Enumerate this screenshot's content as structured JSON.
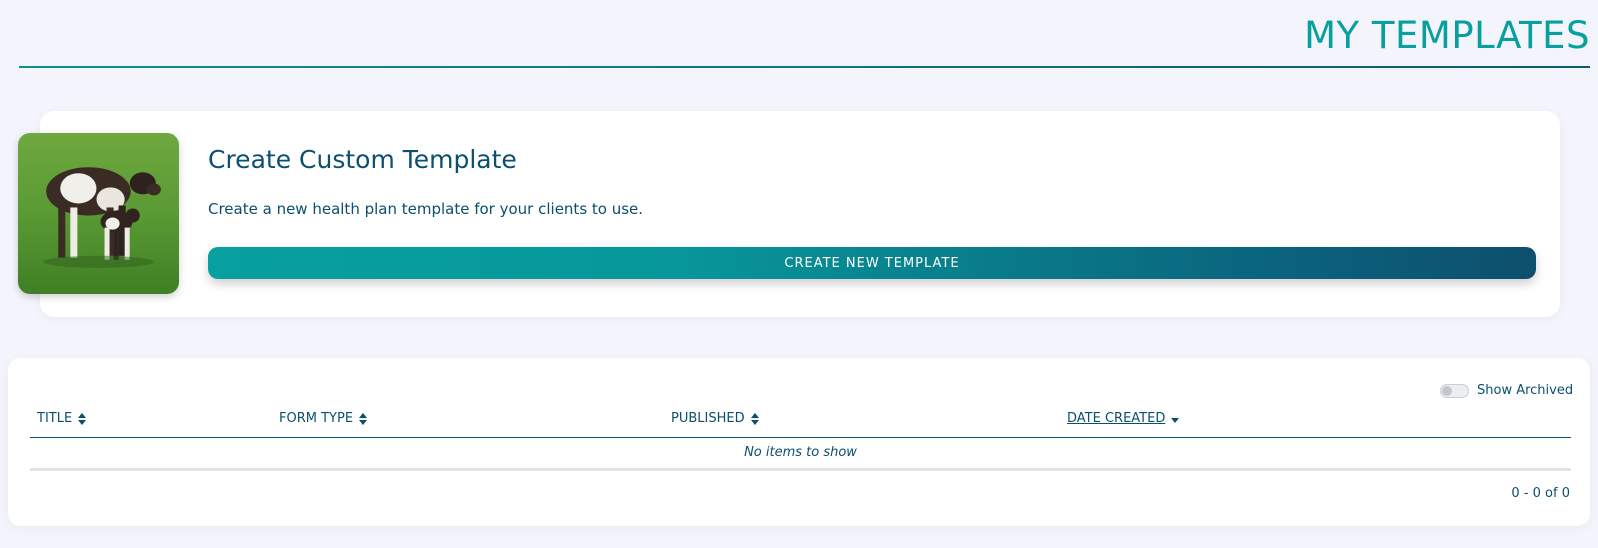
{
  "header": {
    "title": "MY TEMPLATES"
  },
  "create_card": {
    "heading": "Create Custom Template",
    "description": "Create a new health plan template for your clients to use.",
    "button_label": "CREATE NEW TEMPLATE",
    "image": "cow-and-calf-photo"
  },
  "templates_table": {
    "show_archived_label": "Show Archived",
    "show_archived_on": false,
    "columns": [
      {
        "label": "TITLE",
        "sort": "none"
      },
      {
        "label": "FORM TYPE",
        "sort": "none"
      },
      {
        "label": "PUBLISHED",
        "sort": "none"
      },
      {
        "label": "DATE CREATED",
        "sort": "descending"
      }
    ],
    "empty_message": "No items to show",
    "pagination": "0 - 0 of 0"
  },
  "colors": {
    "accent_teal": "#07a09e",
    "primary_navy": "#0b4f6c",
    "background": "#f4f5fc"
  },
  "icons": [
    "sort-icon",
    "sort-desc-icon",
    "toggle-switch"
  ]
}
